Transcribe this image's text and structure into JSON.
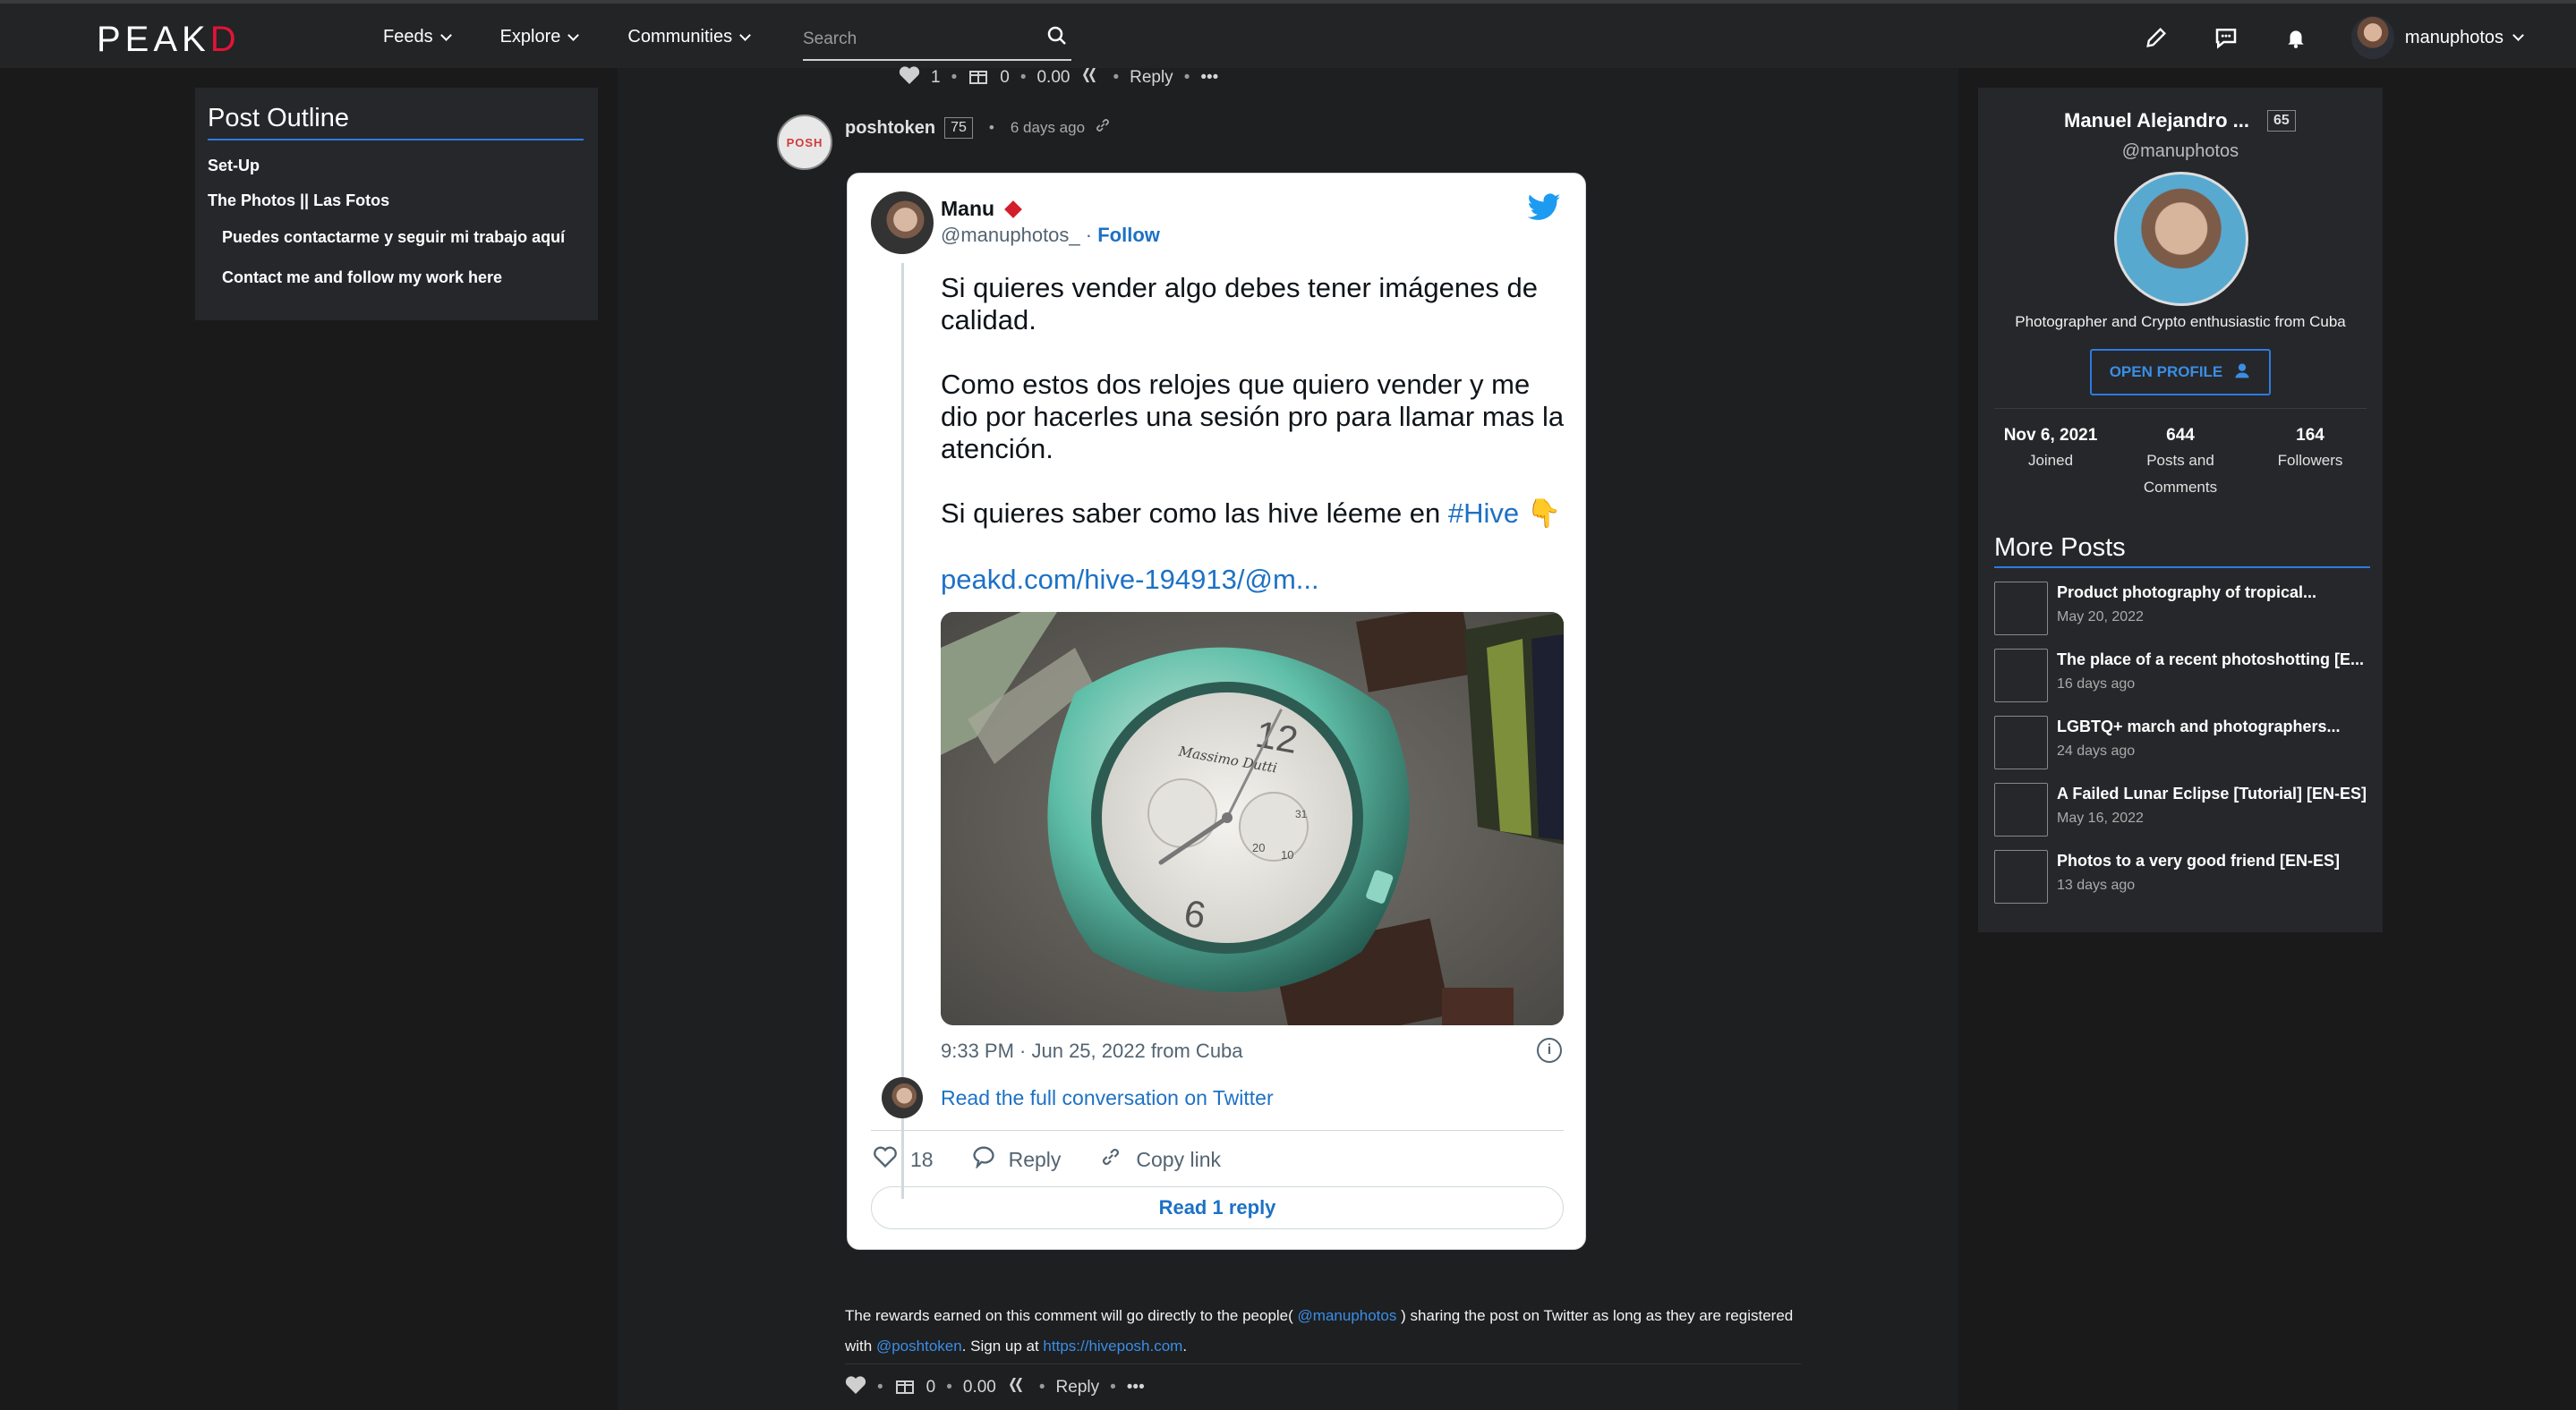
{
  "nav": {
    "logo_left": "PE",
    "logo_mid": "AK",
    "logo_right": "D",
    "menu": [
      "Feeds",
      "Explore",
      "Communities"
    ],
    "search_placeholder": "Search",
    "username": "manuphotos"
  },
  "outline": {
    "title": "Post Outline",
    "items": [
      {
        "label": "Set-Up"
      },
      {
        "label": "The Photos || Las Fotos"
      },
      {
        "label": "Puedes contactarme y seguir mi trabajo aquí"
      },
      {
        "label": "Contact me and follow my work here"
      }
    ]
  },
  "top_actions": {
    "likes": "1",
    "reblogs": "0",
    "payout": "0.00",
    "reply": "Reply",
    "sep": "•",
    "more": "•••"
  },
  "comment": {
    "author": "poshtoken",
    "rep": "75",
    "time": "6 days ago",
    "avatar_text": "POSH"
  },
  "tweet": {
    "name": "Manu",
    "handle": "@manuphotos_",
    "follow": "Follow",
    "text_1": "Si quieres vender algo debes tener imágenes de calidad.\n\nComo estos dos relojes que quiero vender y me dio por hacerles una sesión pro para llamar mas la atención.\n\nSi quieres saber como las hive léeme en ",
    "hashtag": "#Hive",
    "emoji": "👇",
    "link": "peakd.com/hive-194913/@m...",
    "watch_brand": "Massimo Dutti",
    "watch_numbers": [
      "12",
      "6",
      "20",
      "10",
      "31"
    ],
    "timestamp": "9:33 PM · Jun 25, 2022 from Cuba",
    "info": "i",
    "read_conversation": "Read the full conversation on Twitter",
    "likes": "18",
    "reply": "Reply",
    "copy_link": "Copy link",
    "read_reply": "Read 1 reply"
  },
  "footer": {
    "text_a": "The rewards earned on this comment will go directly to the people( ",
    "link_user": "@manuphotos",
    "text_b": " ) sharing the post on Twitter as long as they are registered with ",
    "link_posh": "@poshtoken",
    "text_c": ". Sign up at ",
    "link_site": "https://hiveposh.com",
    "text_d": "."
  },
  "bottom_actions": {
    "reblogs": "0",
    "payout": "0.00",
    "reply": "Reply",
    "sep": "•",
    "more": "•••"
  },
  "profile": {
    "name": "Manuel Alejandro ...",
    "rep": "65",
    "handle": "@manuphotos",
    "bio": "Photographer and Crypto enthusiastic from Cuba",
    "open_profile": "OPEN PROFILE",
    "stats": [
      {
        "value": "Nov 6, 2021",
        "label": "Joined"
      },
      {
        "value": "644",
        "label": "Posts and Comments"
      },
      {
        "value": "164",
        "label": "Followers"
      }
    ]
  },
  "more_posts": {
    "title": "More Posts",
    "items": [
      {
        "title": "Product photography of tropical...",
        "date": "May 20, 2022"
      },
      {
        "title": "The place of a recent photoshotting [E...",
        "date": "16 days ago"
      },
      {
        "title": "LGBTQ+ march and photographers...",
        "date": "24 days ago"
      },
      {
        "title": "A Failed Lunar Eclipse [Tutorial] [EN-ES]",
        "date": "May 16, 2022"
      },
      {
        "title": "Photos to a very good friend [EN-ES]",
        "date": "13 days ago"
      }
    ]
  },
  "colors": {
    "accent": "#2d7be0",
    "brand_red": "#e31337",
    "twitter_blue": "#1d9bf0",
    "link_blue": "#1d71c5"
  }
}
